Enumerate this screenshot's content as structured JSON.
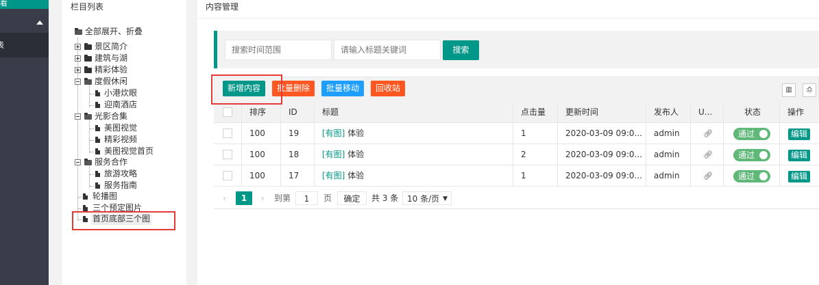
{
  "sidebar": {
    "active_label": "看",
    "sub_label": "表"
  },
  "tree": {
    "title": "栏目列表",
    "root_label": "全部展开、折叠",
    "nodes": [
      {
        "label": "景区简介"
      },
      {
        "label": "建筑与湖"
      },
      {
        "label": "精彩体验"
      },
      {
        "label": "度假休闲"
      },
      {
        "label": "小港炊眼"
      },
      {
        "label": "迎南酒店"
      },
      {
        "label": "光影合集"
      },
      {
        "label": "美图视觉"
      },
      {
        "label": "精彩视频"
      },
      {
        "label": "美图视觉首页"
      },
      {
        "label": "服务合作"
      },
      {
        "label": "旅游攻略"
      },
      {
        "label": "服务指南"
      },
      {
        "label": "轮播图"
      },
      {
        "label": "三个预定图片"
      },
      {
        "label": "首页底部三个图"
      }
    ]
  },
  "main": {
    "title": "内容管理",
    "search": {
      "time_placeholder": "搜索时间范围",
      "keyword_placeholder": "请输入标题关键词",
      "search_label": "搜索"
    },
    "toolbar": {
      "add_label": "新增内容",
      "batch_delete_label": "批量删除",
      "batch_move_label": "批量移动",
      "recycle_label": "回收站"
    },
    "table": {
      "headers": [
        "排序",
        "ID",
        "标题",
        "点击量",
        "更新时间",
        "发布人",
        "U...",
        "状态",
        "操作"
      ],
      "rows": [
        {
          "sort": "100",
          "id": "19",
          "tag": "[有图]",
          "title": "体验",
          "clicks": "1",
          "time": "2020-03-09 09:0...",
          "author": "admin",
          "status": "通过",
          "action": "编辑"
        },
        {
          "sort": "100",
          "id": "18",
          "tag": "[有图]",
          "title": "体验",
          "clicks": "2",
          "time": "2020-03-09 09:0...",
          "author": "admin",
          "status": "通过",
          "action": "编辑"
        },
        {
          "sort": "100",
          "id": "17",
          "tag": "[有图]",
          "title": "体验",
          "clicks": "1",
          "time": "2020-03-09 09:0...",
          "author": "admin",
          "status": "通过",
          "action": "编辑"
        }
      ]
    },
    "pager": {
      "current_page": "1",
      "goto_label": "到第",
      "page_input": "1",
      "page_unit": "页",
      "confirm_label": "确定",
      "total_label": "共 3 条",
      "per_page": "10 条/页"
    }
  },
  "colors": {
    "accent": "#009688",
    "danger": "#ff5722",
    "info": "#1e9fff",
    "highlight_box": "#e53935"
  }
}
